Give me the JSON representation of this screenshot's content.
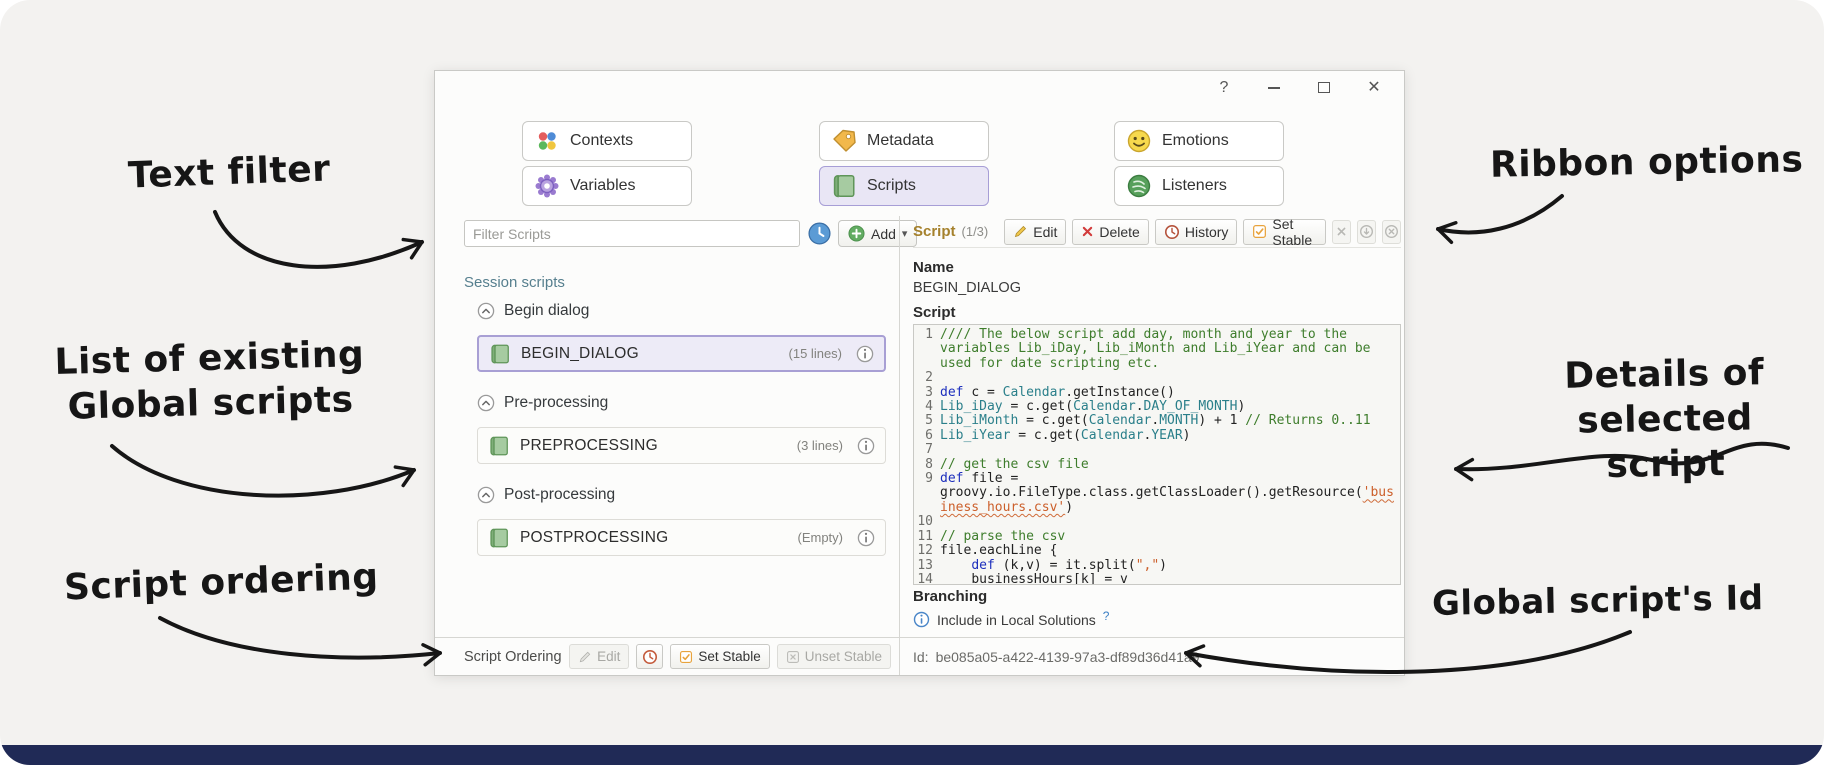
{
  "icons": {
    "help": "?",
    "close": "✕",
    "add_caret": "▾",
    "question": "?",
    "sq_x": "✕"
  },
  "ribbon": {
    "contexts": "Contexts",
    "variables": "Variables",
    "metadata": "Metadata",
    "scripts": "Scripts",
    "emotions": "Emotions",
    "listeners": "Listeners"
  },
  "left_panel": {
    "filter_placeholder": "Filter Scripts",
    "add_label": "Add",
    "section_title": "Session scripts",
    "groups": [
      {
        "title": "Begin dialog",
        "item": {
          "name": "BEGIN_DIALOG",
          "meta": "(15 lines)"
        }
      },
      {
        "title": "Pre-processing",
        "item": {
          "name": "PREPROCESSING",
          "meta": "(3 lines)"
        }
      },
      {
        "title": "Post-processing",
        "item": {
          "name": "POSTPROCESSING",
          "meta": "(Empty)"
        }
      }
    ],
    "footer": {
      "title": "Script Ordering",
      "edit": "Edit",
      "set_stable": "Set Stable",
      "unset_stable": "Unset Stable"
    }
  },
  "right_panel": {
    "title": "Script",
    "count": "(1/3)",
    "buttons": {
      "edit": "Edit",
      "delete": "Delete",
      "history": "History",
      "set_stable": "Set Stable"
    },
    "name_label": "Name",
    "name_value": "BEGIN_DIALOG",
    "script_label": "Script",
    "branching_label": "Branching",
    "include_label": "Include in Local Solutions",
    "id_label": "Id:",
    "id_value": "be085a05-a422-4139-97a3-df89d36d41a9",
    "code_lines": [
      [
        [
          "c",
          "//// The below script add day, month and year to the variables Lib_iDay, Lib_iMonth and Lib_iYear and can be used for date scripting etc."
        ]
      ],
      [],
      [
        [
          "k",
          "def "
        ],
        [
          "p",
          "c = "
        ],
        [
          "t",
          "Calendar"
        ],
        [
          "p",
          ".getInstance()"
        ]
      ],
      [
        [
          "t",
          "Lib_iDay"
        ],
        [
          "p",
          " = c.get("
        ],
        [
          "t",
          "Calendar"
        ],
        [
          "p",
          "."
        ],
        [
          "t",
          "DAY_OF_MONTH"
        ],
        [
          "p",
          ")"
        ]
      ],
      [
        [
          "t",
          "Lib_iMonth"
        ],
        [
          "p",
          " = c.get("
        ],
        [
          "t",
          "Calendar"
        ],
        [
          "p",
          "."
        ],
        [
          "t",
          "MONTH"
        ],
        [
          "p",
          ") + 1 "
        ],
        [
          "c",
          "// Returns 0..11"
        ]
      ],
      [
        [
          "t",
          "Lib_iYear"
        ],
        [
          "p",
          " = c.get("
        ],
        [
          "t",
          "Calendar"
        ],
        [
          "p",
          "."
        ],
        [
          "t",
          "YEAR"
        ],
        [
          "p",
          ")"
        ]
      ],
      [],
      [
        [
          "c",
          "// get the csv file"
        ]
      ],
      [
        [
          "k",
          "def "
        ],
        [
          "p",
          "file = groovy.io.FileType.class.getClassLoader().getResource("
        ],
        [
          "su",
          "'business_hours.csv'"
        ],
        [
          "p",
          ")"
        ]
      ],
      [],
      [
        [
          "c",
          "// parse the csv"
        ]
      ],
      [
        [
          "p",
          "file.eachLine {"
        ]
      ],
      [
        [
          "p",
          "    "
        ],
        [
          "k",
          "def "
        ],
        [
          "p",
          "(k,v) = it.split("
        ],
        [
          "s",
          "\",\""
        ],
        [
          "p",
          ")"
        ]
      ],
      [
        [
          "p",
          "    businessHours[k] = v"
        ]
      ],
      [
        [
          "p",
          "}"
        ]
      ]
    ]
  },
  "annotations": {
    "text_filter": "Text filter",
    "list_line1": "List of existing",
    "list_line2": "Global scripts",
    "script_ordering": "Script ordering",
    "ribbon_options": "Ribbon options",
    "details_line1": "Details of",
    "details_line2": "selected script",
    "global_id": "Global script's Id"
  }
}
